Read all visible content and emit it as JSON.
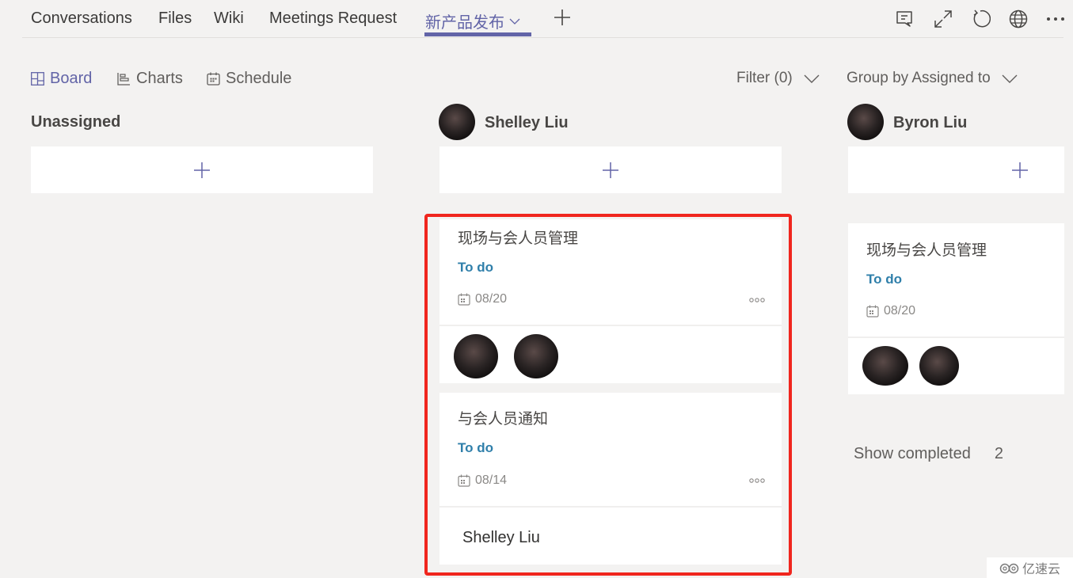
{
  "tabs": [
    {
      "label": "Conversations",
      "active": false
    },
    {
      "label": "Files",
      "active": false
    },
    {
      "label": "Wiki",
      "active": false
    },
    {
      "label": "Meetings Request",
      "active": false
    },
    {
      "label": "新产品发布",
      "active": true
    }
  ],
  "top_icons": [
    "conversation-icon",
    "expand-icon",
    "refresh-icon",
    "globe-icon",
    "more-icon"
  ],
  "views": [
    {
      "label": "Board",
      "icon": "board-icon",
      "active": true
    },
    {
      "label": "Charts",
      "icon": "charts-icon",
      "active": false
    },
    {
      "label": "Schedule",
      "icon": "schedule-icon",
      "active": false
    }
  ],
  "filter": {
    "label": "Filter (0)"
  },
  "group_by": {
    "label": "Group by Assigned to"
  },
  "colors": {
    "accent": "#6264a7",
    "status": "#2f7faa",
    "highlight": "#f0261e"
  },
  "columns": [
    {
      "name": "Unassigned",
      "has_avatar": false
    },
    {
      "name": "Shelley Liu",
      "has_avatar": true
    },
    {
      "name": "Byron Liu",
      "has_avatar": true
    }
  ],
  "tasks": {
    "shelley": [
      {
        "title": "现场与会人员管理",
        "status": "To do",
        "due": "08/20",
        "assignees": [
          "Shelley Liu",
          "Byron Liu"
        ]
      },
      {
        "title": "与会人员通知",
        "status": "To do",
        "due": "08/14",
        "assignee_name": "Shelley Liu"
      }
    ],
    "byron": [
      {
        "title": "现场与会人员管理",
        "status": "To do",
        "due": "08/20",
        "assignees": [
          "Byron Liu",
          "Shelley Liu"
        ]
      }
    ]
  },
  "show_completed": {
    "label": "Show completed",
    "count": "2"
  },
  "watermark": {
    "text": "亿速云"
  }
}
